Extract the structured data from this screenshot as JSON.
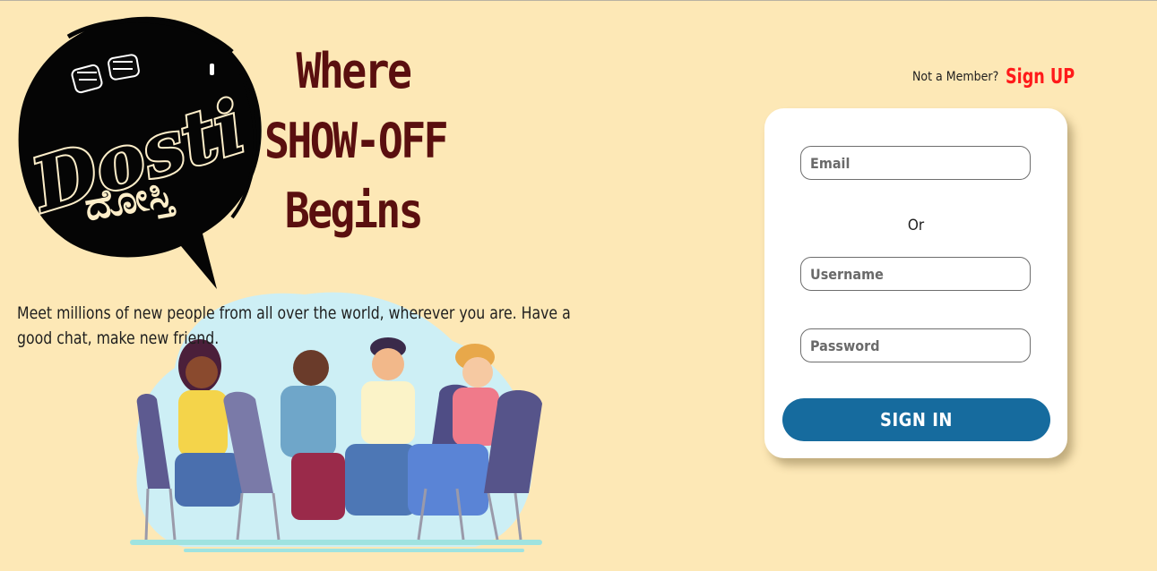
{
  "brand": {
    "logo_text": "Dosti",
    "logo_script": "ದೋಸ್ತಿ"
  },
  "tagline": {
    "line1": "Where",
    "line2": "SHOW-OFF",
    "line3": "Begins"
  },
  "intro": {
    "text": "Meet millions of new people from all over the world, wherever you are. Have a good chat, make new friend."
  },
  "auth_header": {
    "prompt": "Not a Member?",
    "signup_label": "Sign UP"
  },
  "login_form": {
    "email_placeholder": "Email",
    "or_label": "Or",
    "username_placeholder": "Username",
    "password_placeholder": "Password",
    "submit_label": "SIGN IN"
  },
  "colors": {
    "background": "#fde8b6",
    "tagline": "#5a0f0f",
    "signup": "#ff1a1a",
    "button": "#166b9e"
  },
  "icons": [
    "fist-bump-icon",
    "speech-bubble-logo",
    "friends-chatting-illustration"
  ]
}
